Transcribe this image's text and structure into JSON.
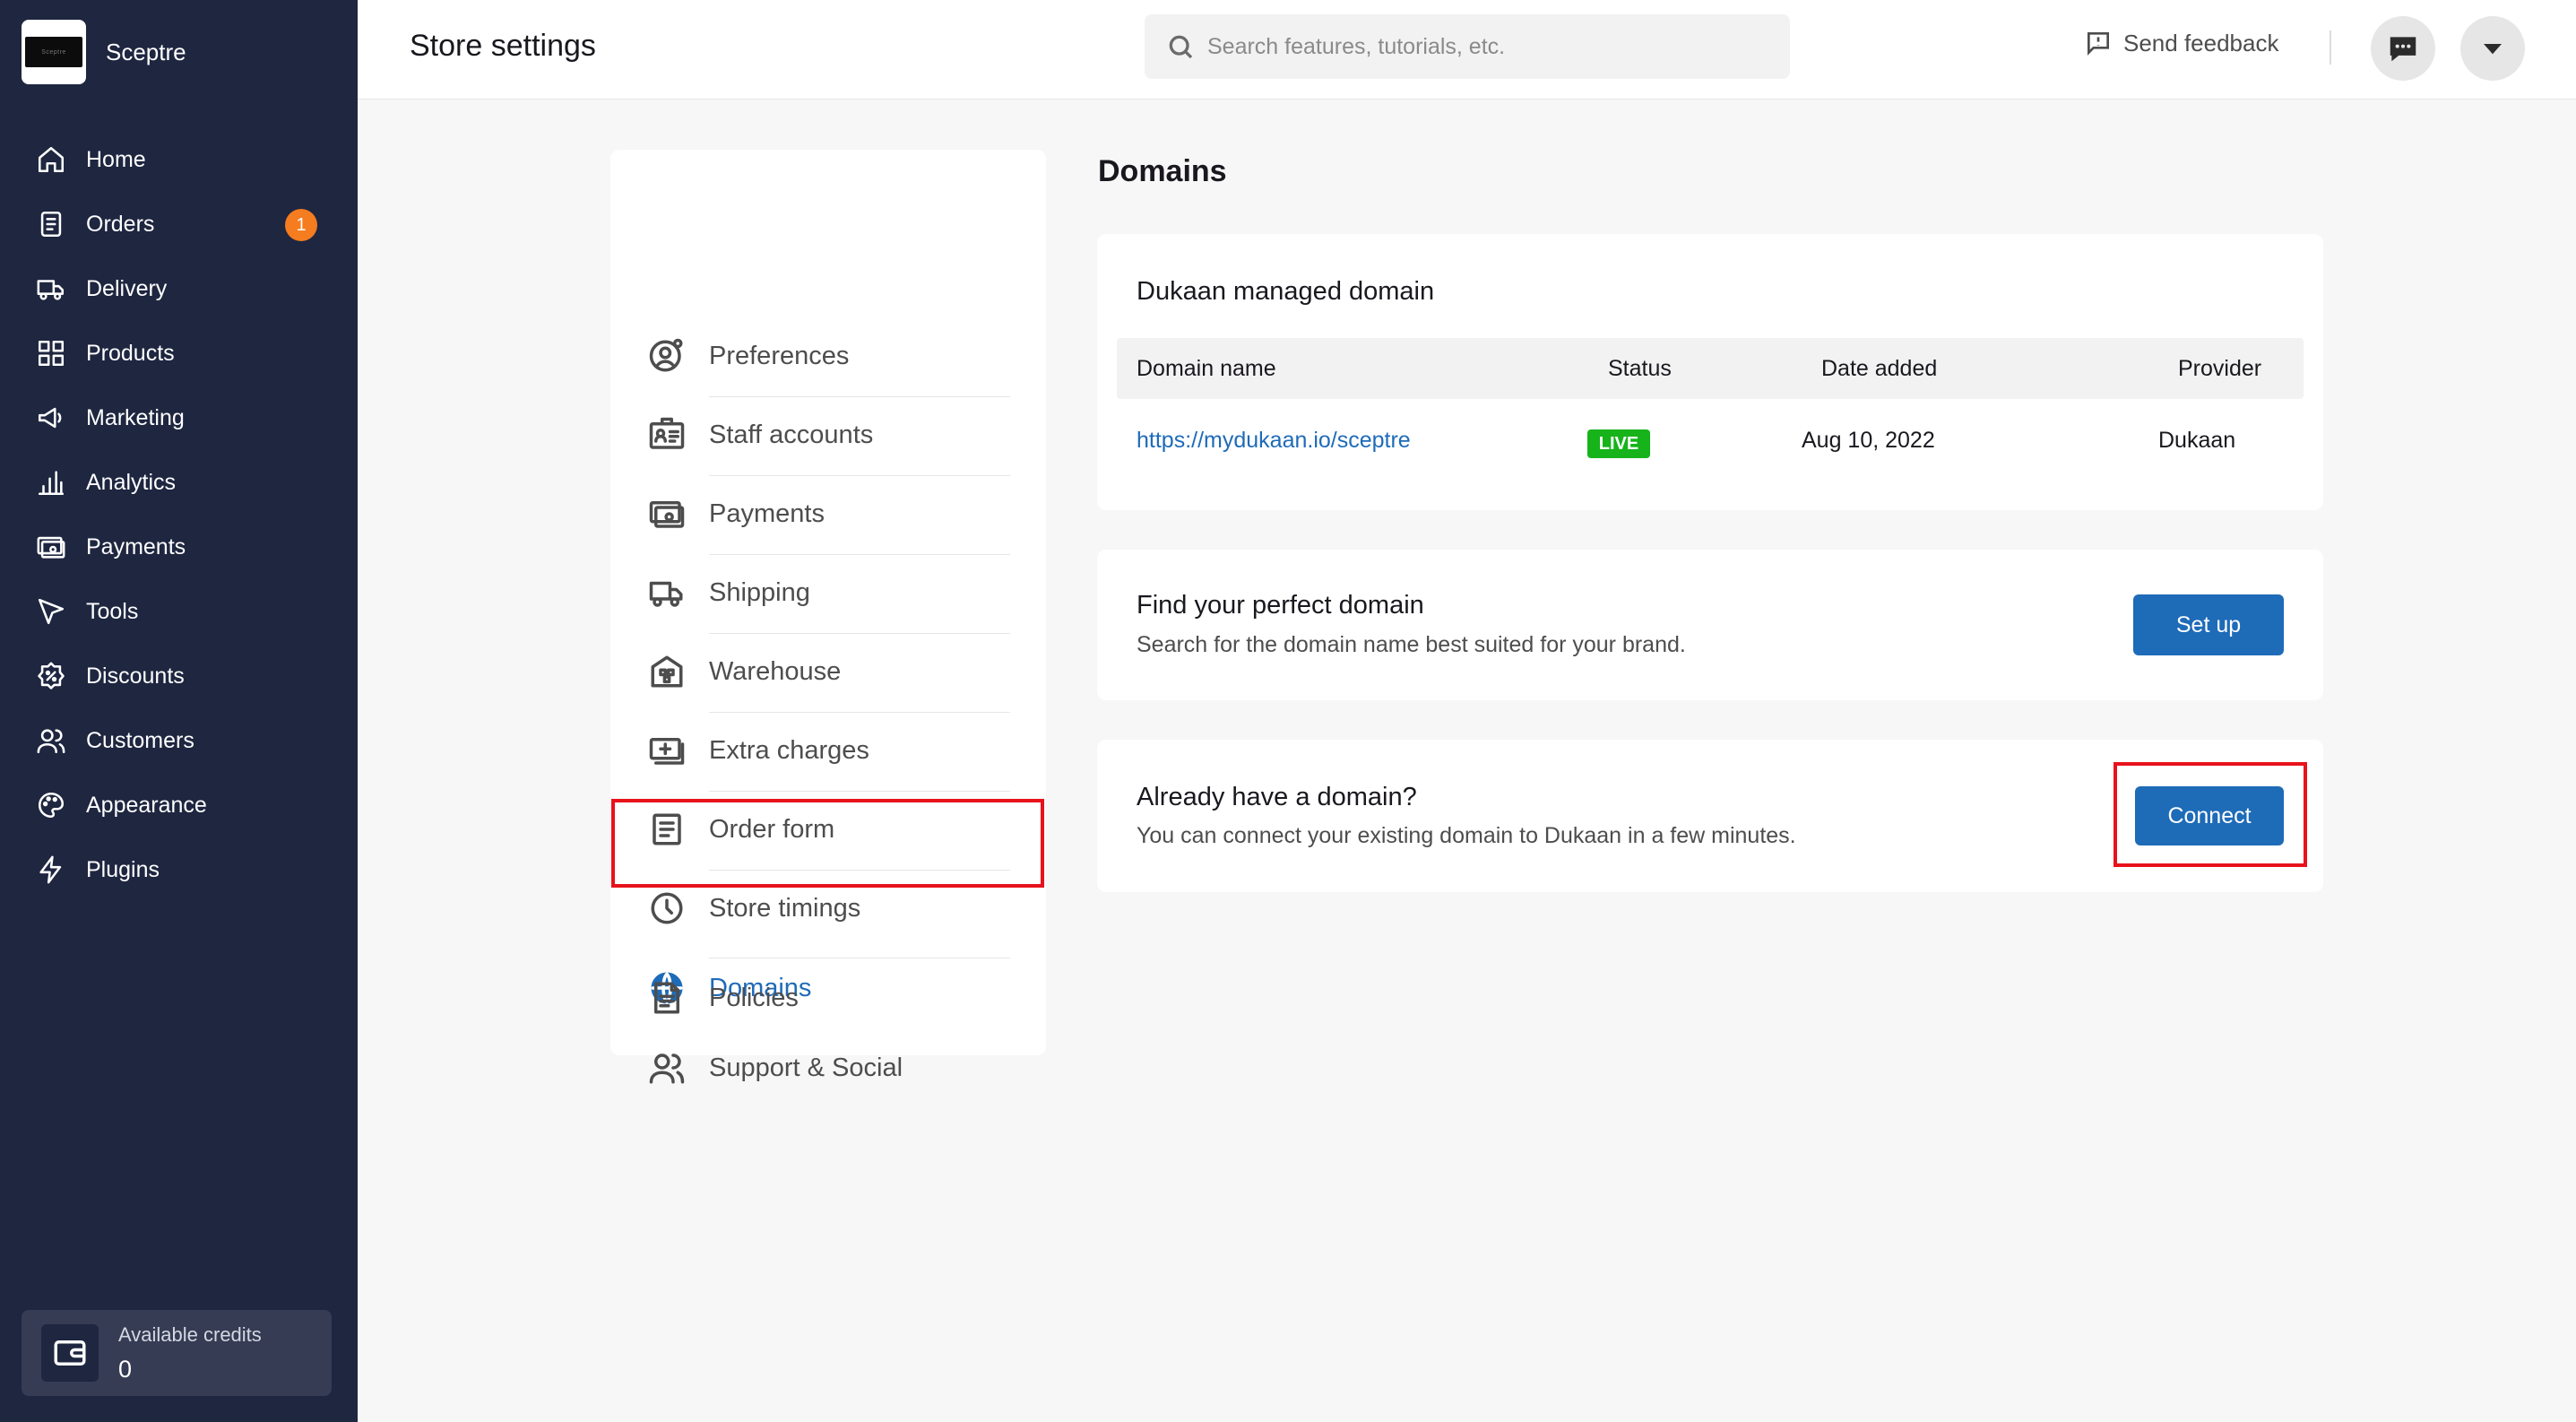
{
  "app": {
    "store_name": "Sceptre",
    "logo_text": "Sceptre"
  },
  "sidebar": {
    "items": [
      {
        "label": "Home",
        "icon": "home-icon"
      },
      {
        "label": "Orders",
        "icon": "orders-icon",
        "badge": "1"
      },
      {
        "label": "Delivery",
        "icon": "truck-icon"
      },
      {
        "label": "Products",
        "icon": "grid-icon"
      },
      {
        "label": "Marketing",
        "icon": "megaphone-icon"
      },
      {
        "label": "Analytics",
        "icon": "bar-chart-icon"
      },
      {
        "label": "Payments",
        "icon": "payments-icon"
      },
      {
        "label": "Tools",
        "icon": "cursor-icon"
      },
      {
        "label": "Discounts",
        "icon": "discount-icon"
      },
      {
        "label": "Customers",
        "icon": "users-icon"
      },
      {
        "label": "Appearance",
        "icon": "palette-icon"
      },
      {
        "label": "Plugins",
        "icon": "lightning-icon"
      }
    ],
    "credits": {
      "label": "Available credits",
      "value": "0"
    }
  },
  "header": {
    "title": "Store settings",
    "search_placeholder": "Search features, tutorials, etc.",
    "feedback_label": "Send feedback"
  },
  "settings_menu": {
    "items": [
      {
        "label": "Preferences",
        "icon": "preferences-icon"
      },
      {
        "label": "Staff accounts",
        "icon": "staff-icon"
      },
      {
        "label": "Payments",
        "icon": "payments-icon"
      },
      {
        "label": "Shipping",
        "icon": "truck-icon"
      },
      {
        "label": "Warehouse",
        "icon": "warehouse-icon"
      },
      {
        "label": "Extra charges",
        "icon": "extra-charges-icon"
      },
      {
        "label": "Order form",
        "icon": "order-form-icon"
      },
      {
        "label": "Store timings",
        "icon": "clock-icon"
      },
      {
        "label": "Domains",
        "icon": "globe-icon",
        "active": true
      },
      {
        "label": "Support & Social",
        "icon": "support-icon"
      },
      {
        "label": "Policies",
        "icon": "policies-icon"
      }
    ]
  },
  "main": {
    "title": "Domains",
    "managed": {
      "heading": "Dukaan managed domain",
      "columns": [
        "Domain name",
        "Status",
        "Date added",
        "Provider"
      ],
      "row": {
        "domain": "https://mydukaan.io/sceptre",
        "status": "LIVE",
        "date_added": "Aug 10, 2022",
        "provider": "Dukaan"
      }
    },
    "find": {
      "heading": "Find your perfect domain",
      "subtext": "Search for the domain name best suited for your brand.",
      "button": "Set up"
    },
    "connect": {
      "heading": "Already have a domain?",
      "subtext": "You can connect your existing domain to Dukaan in a few minutes.",
      "button": "Connect"
    }
  },
  "colors": {
    "sidebar_bg": "#1e2640",
    "accent": "#1e6bb8",
    "badge": "#f57c1f",
    "live": "#17b31b",
    "highlight": "#e8121b"
  }
}
